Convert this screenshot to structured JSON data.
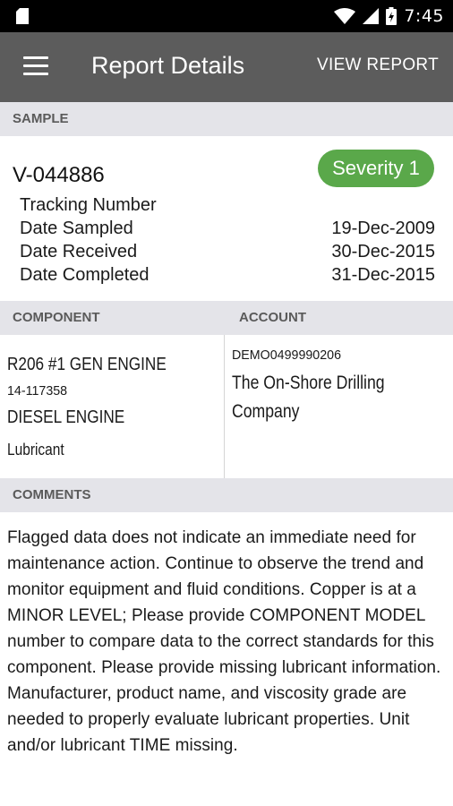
{
  "status_bar": {
    "time": "7:45",
    "icons": [
      "sim-card-icon",
      "wifi-icon",
      "signal-icon",
      "battery-charging-icon"
    ]
  },
  "app_bar": {
    "title": "Report Details",
    "action": "VIEW REPORT",
    "menu_icon": "hamburger-menu-icon"
  },
  "sample": {
    "header": "SAMPLE",
    "id": "V-044886",
    "severity": "Severity 1",
    "severity_color": "#5aa84a",
    "rows": [
      {
        "label": "Tracking Number",
        "value": ""
      },
      {
        "label": "Date Sampled",
        "value": "19-Dec-2009"
      },
      {
        "label": "Date Received",
        "value": "30-Dec-2015"
      },
      {
        "label": "Date Completed",
        "value": "31-Dec-2015"
      }
    ]
  },
  "component": {
    "header": "COMPONENT",
    "name": "R206 #1 GEN ENGINE",
    "serial": "14-117358",
    "type": "DIESEL ENGINE",
    "fluid": "Lubricant"
  },
  "account": {
    "header": "ACCOUNT",
    "number": "DEMO0499990206",
    "name_line1": "The On-Shore Drilling",
    "name_line2": "Company"
  },
  "comments": {
    "header": "COMMENTS",
    "text": "Flagged data does not indicate an immediate need for maintenance action. Continue to observe the trend and monitor equipment and fluid conditions. Copper is at a MINOR LEVEL; Please provide COMPONENT MODEL number to compare data to the correct standards for this component. Please provide missing lubricant information. Manufacturer, product name, and viscosity grade are needed to properly evaluate lubricant properties. Unit and/or lubricant TIME missing."
  }
}
